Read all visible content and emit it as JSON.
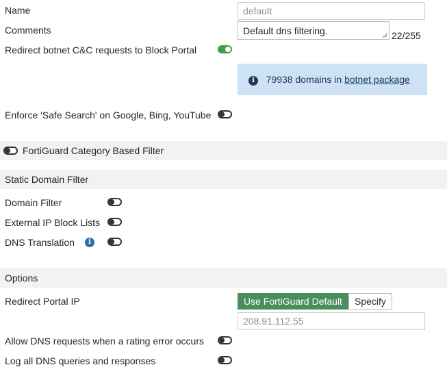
{
  "fields": {
    "name_label": "Name",
    "name_placeholder": "default",
    "comments_label": "Comments",
    "comments_value": "Default dns filtering.",
    "comments_counter": "22/255"
  },
  "botnet": {
    "label": "Redirect botnet C&C requests to Block Portal",
    "enabled": true,
    "info_count": "79938 domains in",
    "info_link": "botnet package"
  },
  "safe_search": {
    "label": "Enforce 'Safe Search' on Google, Bing, YouTube",
    "enabled": false
  },
  "fortiguard": {
    "label": "FortiGuard Category Based Filter",
    "enabled": false
  },
  "static_domain": {
    "section_title": "Static Domain Filter",
    "domain_filter": "Domain Filter",
    "external_ip": "External IP Block Lists",
    "dns_translation": "DNS Translation"
  },
  "options": {
    "section_title": "Options",
    "redirect_portal_label": "Redirect Portal IP",
    "btn_default": "Use FortiGuard Default",
    "btn_specify": "Specify",
    "portal_ip": "208.91.112.55",
    "allow_dns_label": "Allow DNS requests when a rating error occurs",
    "log_dns_label": "Log all DNS queries and responses"
  },
  "colors": {
    "toggle_on": "#4a9a4a",
    "active_button": "#4b8e5e",
    "info_bg": "#cde3f5",
    "section_bg": "#f2f2f2"
  }
}
